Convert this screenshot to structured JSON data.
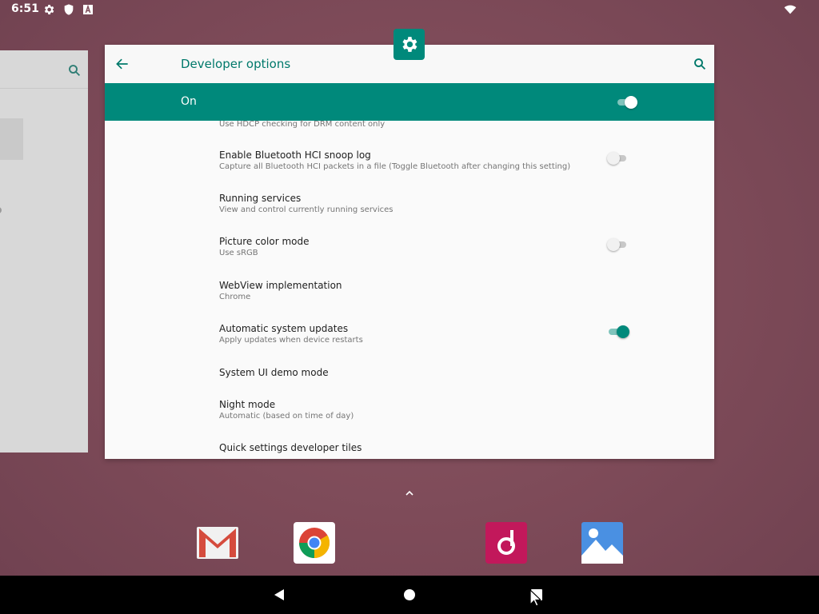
{
  "status_bar": {
    "time": "6:51",
    "icons": [
      "settings-gear-icon",
      "shield-icon",
      "a-box-icon"
    ],
    "right_icons": [
      "wifi-icon"
    ]
  },
  "header": {
    "title": "Developer options",
    "back_icon": "arrow-left-icon",
    "search_icon": "search-icon"
  },
  "master_switch": {
    "label": "On",
    "state": true
  },
  "list": {
    "partial_summary": "Use HDCP checking for DRM content only",
    "items": [
      {
        "title": "Enable Bluetooth HCI snoop log",
        "summary": "Capture all Bluetooth HCI packets in a file (Toggle Bluetooth after changing this setting)",
        "toggle": false
      },
      {
        "title": "Running services",
        "summary": "View and control currently running services"
      },
      {
        "title": "Picture color mode",
        "summary": "Use sRGB",
        "toggle": false
      },
      {
        "title": "WebView implementation",
        "summary": "Chrome"
      },
      {
        "title": "Automatic system updates",
        "summary": "Apply updates when device restarts",
        "toggle": true
      },
      {
        "title": "System UI demo mode",
        "summary": ""
      },
      {
        "title": "Night mode",
        "summary": "Automatic (based on time of day)"
      },
      {
        "title": "Quick settings developer tiles",
        "summary": ""
      }
    ]
  },
  "dock": {
    "apps": [
      "gmail-icon",
      "chrome-icon",
      "music-icon",
      "photos-icon"
    ]
  },
  "nav": {
    "buttons": [
      "back-icon",
      "home-icon",
      "recents-icon"
    ]
  },
  "colors": {
    "accent": "#00897b",
    "title_text": "#00796b",
    "wallpaper": "#7d4a58"
  }
}
